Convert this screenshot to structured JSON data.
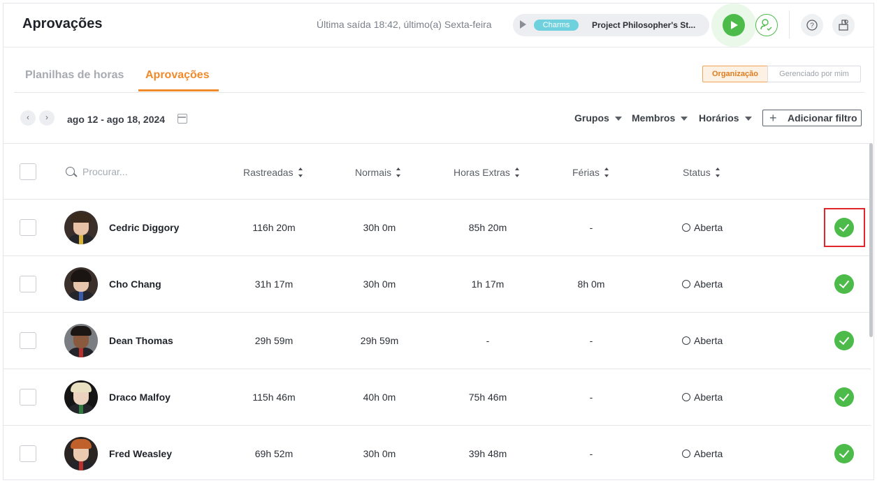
{
  "header": {
    "title": "Aprovações",
    "last_exit": "Última saída 18:42, último(a) Sexta-feira",
    "timer": {
      "tag": "Charms",
      "tag_color": "#6fd0de",
      "project": "Project Philosopher's St..."
    },
    "icons": {
      "play": "play-icon",
      "user": "user-check-icon",
      "help": "question-icon",
      "org": "organization-icon"
    }
  },
  "tabs": [
    {
      "label": "Planilhas de horas",
      "active": false
    },
    {
      "label": "Aprovações",
      "active": true
    }
  ],
  "scope_toggle": {
    "options": [
      "Organização",
      "Gerenciado por mim"
    ],
    "selected": "Organização"
  },
  "filters": {
    "date_range": "ago 12 - ago 18, 2024",
    "dropdowns": [
      "Grupos",
      "Membros",
      "Horários"
    ],
    "add_filter": "Adicionar filtro"
  },
  "table": {
    "search_placeholder": "Procurar...",
    "columns": [
      "Rastreadas",
      "Normais",
      "Horas Extras",
      "Férias",
      "Status"
    ],
    "rows": [
      {
        "name": "Cedric Diggory",
        "tracked": "116h 20m",
        "regular": "30h 0m",
        "overtime": "85h 20m",
        "vacation": "-",
        "status": "Aberta"
      },
      {
        "name": "Cho Chang",
        "tracked": "31h 17m",
        "regular": "30h 0m",
        "overtime": "1h 17m",
        "vacation": "8h 0m",
        "status": "Aberta"
      },
      {
        "name": "Dean Thomas",
        "tracked": "29h 59m",
        "regular": "29h 59m",
        "overtime": "-",
        "vacation": "-",
        "status": "Aberta"
      },
      {
        "name": "Draco Malfoy",
        "tracked": "115h 46m",
        "regular": "40h 0m",
        "overtime": "75h 46m",
        "vacation": "-",
        "status": "Aberta"
      },
      {
        "name": "Fred Weasley",
        "tracked": "69h 52m",
        "regular": "30h 0m",
        "overtime": "39h 48m",
        "vacation": "-",
        "status": "Aberta"
      }
    ]
  },
  "colors": {
    "accent": "#f08a2a",
    "approve": "#4cbb4a",
    "highlight": "#e0262a"
  }
}
